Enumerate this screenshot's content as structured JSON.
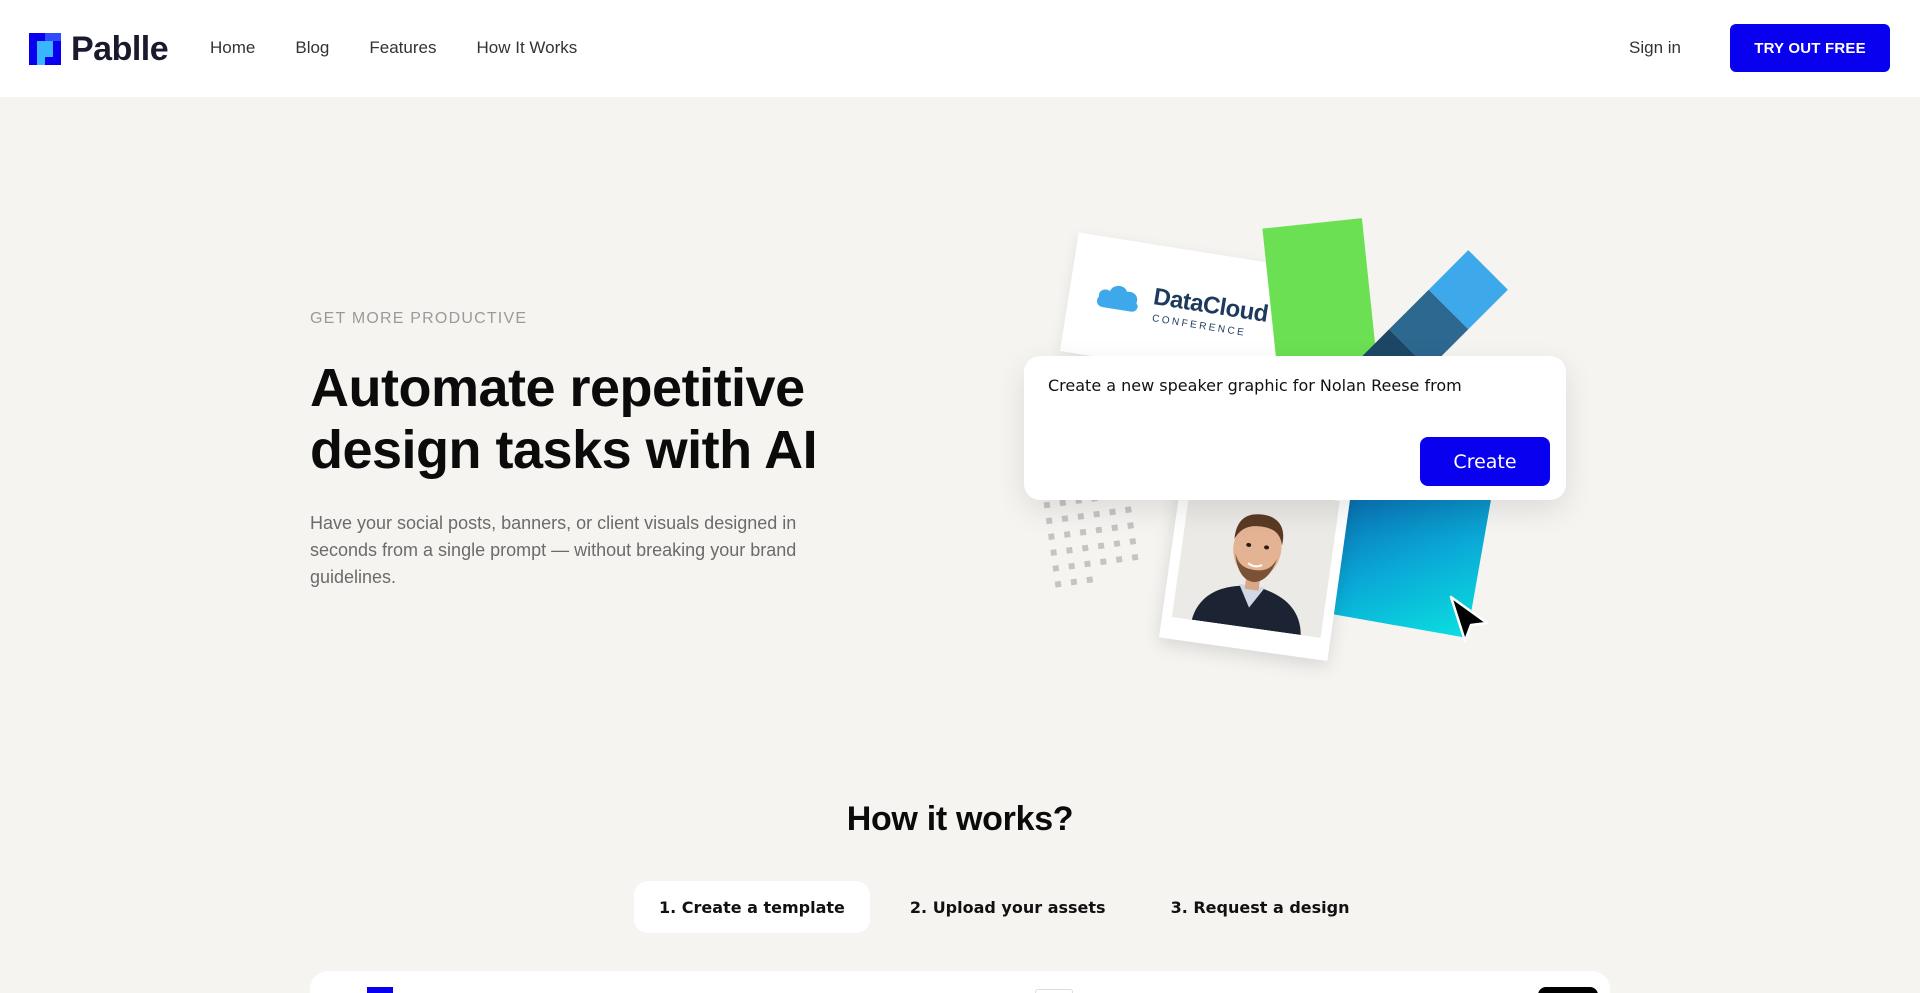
{
  "header": {
    "brand": "Pablle",
    "nav": [
      {
        "label": "Home"
      },
      {
        "label": "Blog"
      },
      {
        "label": "Features"
      },
      {
        "label": "How It Works"
      }
    ],
    "signin_label": "Sign in",
    "cta_label": "TRY OUT FREE"
  },
  "hero": {
    "eyebrow": "GET MORE PRODUCTIVE",
    "title": "Automate repetitive design tasks with AI",
    "description": "Have your social posts, banners, or client visuals designed in seconds from a single prompt — without breaking your brand guidelines."
  },
  "illustration": {
    "card_brand": "DataCloud",
    "card_sub": "CONFERENCE",
    "prompt_text": "Create a new speaker graphic for Nolan Reese from",
    "create_label": "Create"
  },
  "how_it_works": {
    "title": "How it works?",
    "tabs": [
      {
        "label": "1. Create a template",
        "active": true
      },
      {
        "label": "2. Upload your assets",
        "active": false
      },
      {
        "label": "3. Request a design",
        "active": false
      }
    ]
  },
  "colors": {
    "accent": "#0800ee",
    "background": "#f5f4f1",
    "green": "#6be052",
    "sky": "#3ea9ea"
  },
  "icons": {
    "logo": "pablle-logo-icon",
    "cloud": "cloud-icon",
    "cursor": "cursor-arrow-icon"
  }
}
